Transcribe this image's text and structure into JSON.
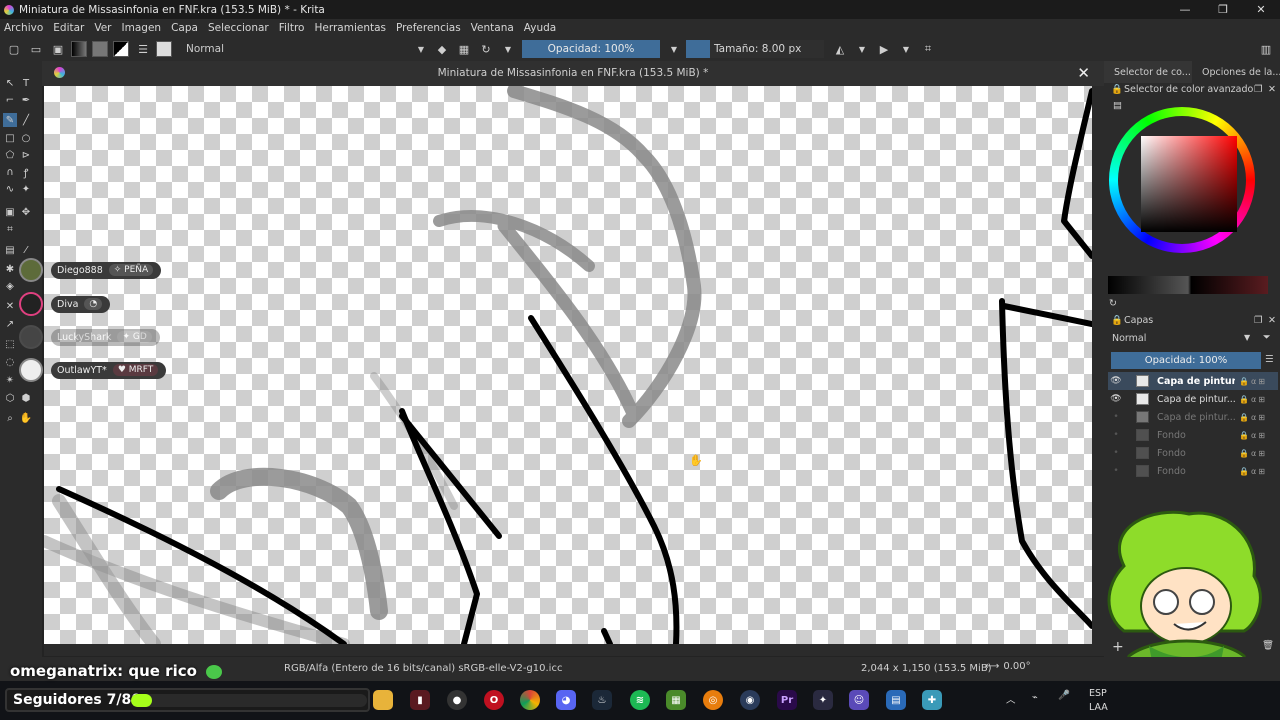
{
  "window": {
    "title": "Miniatura de Missasinfonia en FNF.kra (153.5 MiB) * - Krita",
    "controls": {
      "minimize": "—",
      "maximize": "❐",
      "close": "✕"
    }
  },
  "menu": [
    "Archivo",
    "Editar",
    "Ver",
    "Imagen",
    "Capa",
    "Seleccionar",
    "Filtro",
    "Herramientas",
    "Preferencias",
    "Ventana",
    "Ayuda"
  ],
  "toolbar": {
    "blend_mode": "Normal",
    "opacity_label": "Opacidad: 100%",
    "size_label": "Tamaño: 8.00 px"
  },
  "document": {
    "tab_title": "Miniatura de Missasinfonia en FNF.kra (153.5 MiB) *",
    "close_glyph": "✕"
  },
  "dock": {
    "tabs": [
      "Selector de co...",
      "Opciones de la..."
    ],
    "color_panel_title": "Selector de color avanzado",
    "layers_panel_title": "Capas",
    "layers_blend": "Normal",
    "layers_opacity": "Opacidad:  100%",
    "layers": [
      {
        "name": "Capa de pintur...",
        "visible": true,
        "selected": true
      },
      {
        "name": "Capa de pintur...",
        "visible": true,
        "selected": false
      },
      {
        "name": "Capa de pintur...",
        "visible": false,
        "selected": false
      },
      {
        "name": "Fondo",
        "visible": false,
        "selected": false
      },
      {
        "name": "Fondo",
        "visible": false,
        "selected": false
      },
      {
        "name": "Fondo",
        "visible": false,
        "selected": false
      }
    ]
  },
  "status": {
    "colorspace": "RGB/Alfa (Entero de 16 bits/canal)  sRGB-elle-V2-g10.icc",
    "dimensions": "2,044 x 1,150 (153.5 MiB)",
    "rotation": "0.00°"
  },
  "stream": {
    "chat": [
      {
        "user": "Diego888",
        "badge": "✧ PEÑA"
      },
      {
        "user": "Diva",
        "badge": "◔"
      },
      {
        "user": "LuckyShark",
        "badge": "✦ GD"
      },
      {
        "user": "OutlawYT*",
        "badge": "♥ MRFT"
      }
    ],
    "message": "omeganatrix: que rico",
    "followers_label": "Seguidores 7/80",
    "followers_progress": 0.0875
  },
  "tray": {
    "lang_top": "ESP",
    "lang_bottom": "LAA"
  },
  "colors": {
    "accent": "#3f6d99",
    "progress": "#a6ff1a",
    "mascot_hair": "#8edc2a"
  }
}
